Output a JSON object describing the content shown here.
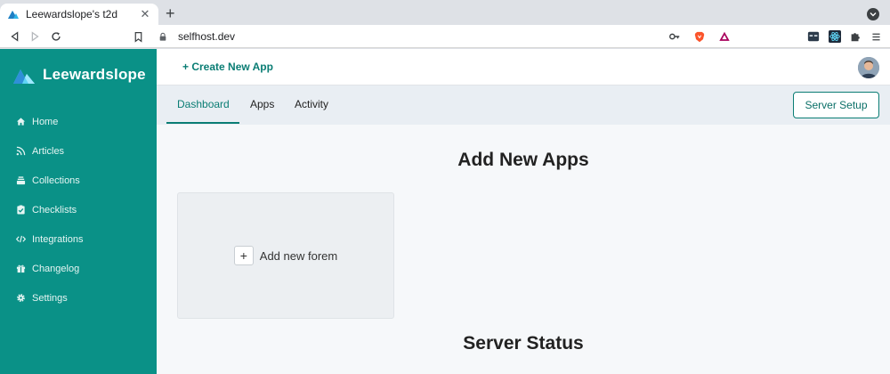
{
  "browser": {
    "tab_title": "Leewardslope's t2d",
    "tab_close": "✕",
    "new_tab": "+",
    "url": "selfhost.dev"
  },
  "sidebar": {
    "brand": "Leewardslope",
    "items": [
      {
        "label": "Home",
        "icon": "home-icon"
      },
      {
        "label": "Articles",
        "icon": "rss-icon"
      },
      {
        "label": "Collections",
        "icon": "collections-icon"
      },
      {
        "label": "Checklists",
        "icon": "clipboard-check-icon"
      },
      {
        "label": "Integrations",
        "icon": "code-icon"
      },
      {
        "label": "Changelog",
        "icon": "gift-icon"
      },
      {
        "label": "Settings",
        "icon": "gear-icon"
      }
    ]
  },
  "topbar": {
    "create_app": "+ Create New App"
  },
  "tabs": {
    "items": [
      "Dashboard",
      "Apps",
      "Activity"
    ],
    "active": "Dashboard",
    "server_setup": "Server Setup"
  },
  "content": {
    "add_new_apps_title": "Add New Apps",
    "add_new_forem_plus": "+",
    "add_new_forem": "Add new forem",
    "server_status_title": "Server Status"
  },
  "colors": {
    "sidebar": "#0a9187",
    "accent": "#0a7d74",
    "content_bg": "#f6f8fa"
  }
}
